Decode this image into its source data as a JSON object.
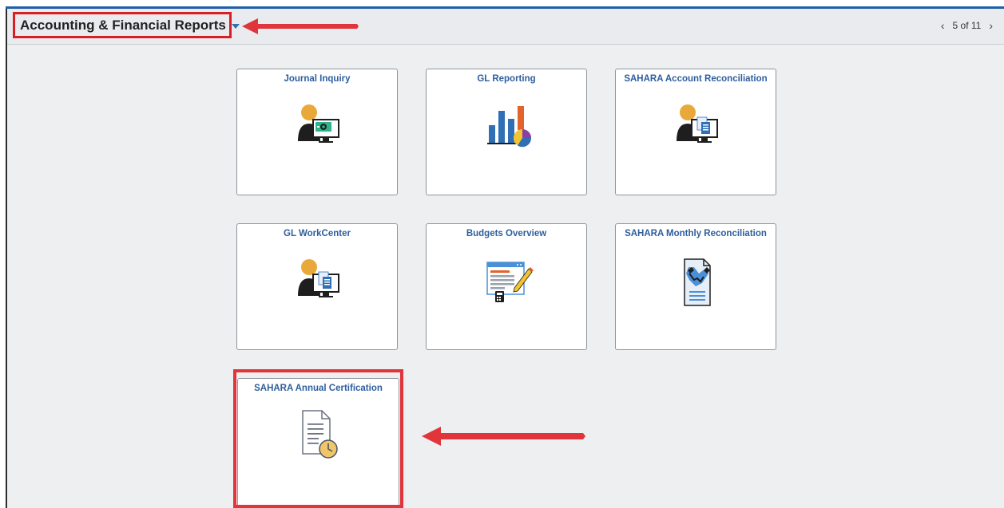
{
  "header": {
    "title": "Accounting & Financial Reports",
    "caret_icon": "caret-down-icon",
    "pager": {
      "prev_icon": "chevron-left-icon",
      "text": "5 of 11",
      "next_icon": "chevron-right-icon"
    }
  },
  "tiles": [
    {
      "title": "Journal Inquiry",
      "icon": "person-monitor-gear-icon"
    },
    {
      "title": "GL Reporting",
      "icon": "bar-pie-chart-icon"
    },
    {
      "title": "SAHARA Account Reconciliation",
      "icon": "person-monitor-document-icon"
    },
    {
      "title": "GL WorkCenter",
      "icon": "person-monitor-document-icon"
    },
    {
      "title": "Budgets Overview",
      "icon": "budget-document-pencil-icon"
    },
    {
      "title": "SAHARA Monthly Reconciliation",
      "icon": "handshake-document-icon"
    },
    {
      "title": "SAHARA Annual Certification",
      "icon": "document-clock-icon"
    }
  ],
  "colors": {
    "accent_blue": "#2d5e9e",
    "highlight_red": "#d91f26",
    "background": "#edeff1"
  }
}
